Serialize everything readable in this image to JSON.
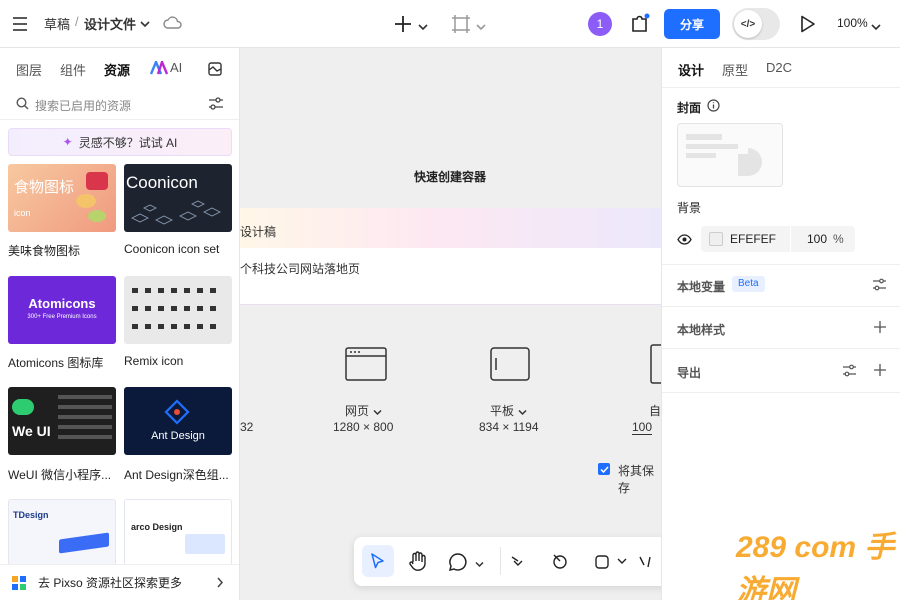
{
  "topbar": {
    "breadcrumb_root": "草稿",
    "separator": "/",
    "file_name": "设计文件",
    "avatar_number": "1",
    "share_label": "分享",
    "code_toggle": "</>",
    "zoom": "100%"
  },
  "left": {
    "tabs": [
      "图层",
      "组件",
      "资源",
      "AI"
    ],
    "search_placeholder": "搜索已启用的资源",
    "ai_banner": "灵感不够？试试 AI",
    "cards": [
      {
        "label": "美味食物图标",
        "thumb_title": "食物图标",
        "thumb_sub": "icon"
      },
      {
        "label": "Coonicon icon set",
        "thumb_title": "Coonicon"
      },
      {
        "label": "Atomicons 图标库",
        "thumb_title": "Atomicons",
        "thumb_sub": "300+ Free Premium Icons"
      },
      {
        "label": "Remix icon"
      },
      {
        "label": "WeUI 微信小程序...",
        "thumb_title": "We UI"
      },
      {
        "label": "Ant Design深色组...",
        "thumb_title": "Ant Design"
      },
      {
        "label": "",
        "thumb_title": "TDesign"
      },
      {
        "label": "",
        "thumb_title": "arco Design"
      }
    ],
    "footer": "去 Pixso 资源社区探索更多"
  },
  "canvas": {
    "quick_title": "快速创建容器",
    "banner_text": "设计稿",
    "row_text": "个科技公司网站落地页",
    "left_size_fragment": "32",
    "devices": [
      {
        "label": "网页",
        "size": "1280 × 800"
      },
      {
        "label": "平板",
        "size": "834 × 1194"
      },
      {
        "label": "自",
        "size": "100"
      }
    ],
    "checkbox_label": "将其保存"
  },
  "right": {
    "tabs": [
      "设计",
      "原型",
      "D2C"
    ],
    "cover_label": "封面",
    "bg_label": "背景",
    "bg_hex": "EFEFEF",
    "bg_opacity": "100",
    "bg_opacity_unit": "%",
    "local_vars": "本地变量",
    "beta": "Beta",
    "local_styles": "本地样式",
    "export": "导出"
  },
  "watermark": "289 com 手游网",
  "colors": {
    "primary": "#1e6fff",
    "avatar": "#8b5cf6",
    "canvas_bg": "#efefef",
    "watermark": "#f7a21c"
  }
}
